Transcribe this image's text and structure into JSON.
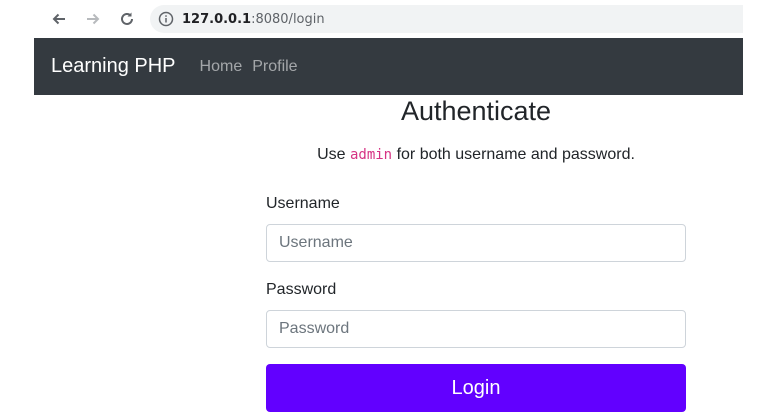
{
  "browser": {
    "url_host": "127.0.0.1",
    "url_rest": ":8080/login",
    "icons": [
      "back-arrow-icon",
      "forward-arrow-icon",
      "reload-icon",
      "info-icon"
    ]
  },
  "navbar": {
    "brand": "Learning PHP",
    "links": [
      "Home",
      "Profile"
    ],
    "bg_color": "#343a40"
  },
  "page": {
    "title": "Authenticate",
    "hint_prefix": "Use ",
    "hint_code": "admin",
    "hint_suffix": " for both username and password."
  },
  "form": {
    "username_label": "Username",
    "username_placeholder": "Username",
    "password_label": "Password",
    "password_placeholder": "Password",
    "submit_label": "Login",
    "submit_color": "#6200ff"
  }
}
